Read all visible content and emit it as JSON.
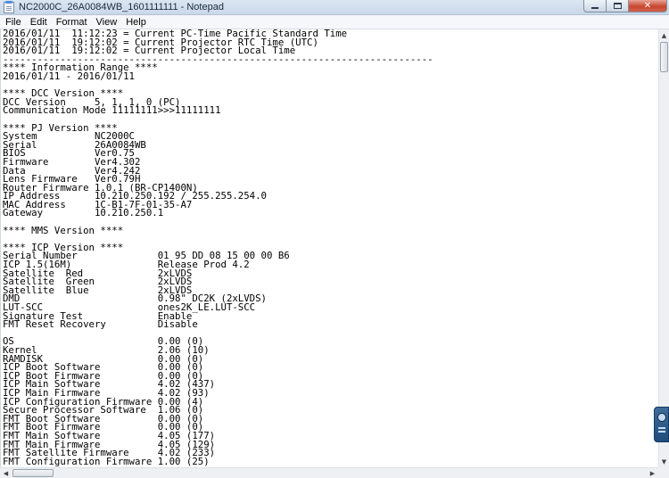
{
  "window": {
    "title": "NC2000C_26A0084WB_1601111111 - Notepad",
    "close_glyph": "✕"
  },
  "menu": {
    "items": [
      "File",
      "Edit",
      "Format",
      "View",
      "Help"
    ]
  },
  "document": {
    "lines": [
      "2016/01/11  11:12:23 = Current PC-Time Pacific Standard Time",
      "2016/01/11  19:12:02 = Current Projector RTC Time (UTC)",
      "2016/01/11  19:12:02 = Current Projector Local Time",
      "---------------------------------------------------------------------------",
      "**** Information Range ****",
      "2016/01/11 - 2016/01/11",
      "",
      "**** DCC Version ****",
      "DCC Version     5, 1, 1, 0 (PC)",
      "Communication Mode 11111111>>>11111111",
      "",
      "**** PJ Version ****",
      "System          NC2000C",
      "Serial          26A0084WB",
      "BIOS            Ver0.75",
      "Firmware        Ver4.302",
      "Data            Ver4.242",
      "Lens Firmware   Ver0.79H",
      "Router Firmware 1.0.1 (BR-CP1400N)",
      "IP Address      10.210.250.192 / 255.255.254.0",
      "MAC Address     1C-B1-7F-01-35-A7",
      "Gateway         10.210.250.1",
      "",
      "**** MMS Version ****",
      "",
      "**** ICP Version ****",
      "Serial Number              01 95 DD 08 15 00 00 B6",
      "ICP 1.5(16M)               Release Prod 4.2",
      "Satellite  Red             2xLVDS",
      "Satellite  Green           2xLVDS",
      "Satellite  Blue            2xLVDS",
      "DMD                        0.98\" DC2K (2xLVDS)",
      "LUT-SCC                    ones2K_LE.LUT-SCC",
      "Signature Test             Enable",
      "FMT Reset Recovery         Disable",
      "",
      "OS                         0.00 (0)",
      "Kernel                     2.06 (10)",
      "RAMDISK                    0.00 (0)",
      "ICP Boot Software          0.00 (0)",
      "ICP Boot Firmware          0.00 (0)",
      "ICP Main Software          4.02 (437)",
      "ICP Main Firmware          4.02 (93)",
      "ICP Configuration Firmware 0.00 (4)",
      "Secure Processor Software  1.06 (0)",
      "FMT Boot Software          0.00 (0)",
      "FMT Boot Firmware          0.00 (0)",
      "FMT Main Software          4.05 (177)",
      "FMT Main Firmware          4.05 (129)",
      "FMT Satellite Firmware     4.02 (233)",
      "FMT Configuration Firmware 1.00 (25)"
    ]
  }
}
